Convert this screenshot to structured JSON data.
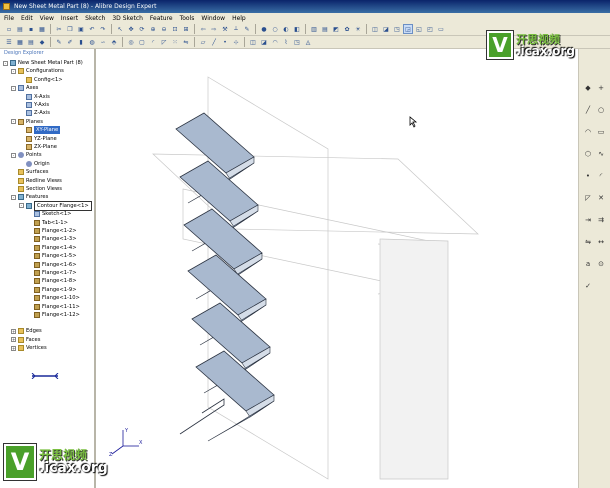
{
  "window": {
    "title": "New Sheet Metal Part (8) - Alibre Design Expert"
  },
  "menu": [
    "File",
    "Edit",
    "View",
    "Insert",
    "Sketch",
    "3D Sketch",
    "Feature",
    "Tools",
    "Window",
    "Help"
  ],
  "explorer": {
    "title": "Design Explorer",
    "items": [
      {
        "label": "New Sheet Metal Part (8)",
        "level": 0,
        "icon": "part-icon",
        "exp": "-"
      },
      {
        "label": "Configurations",
        "level": 1,
        "icon": "folder-icon",
        "exp": "-"
      },
      {
        "label": "Config<1>",
        "level": 2,
        "icon": "config-icon",
        "exp": ""
      },
      {
        "label": "Axes",
        "level": 1,
        "icon": "axes-icon",
        "exp": "-"
      },
      {
        "label": "X-Axis",
        "level": 2,
        "icon": "axis-icon",
        "exp": ""
      },
      {
        "label": "Y-Axis",
        "level": 2,
        "icon": "axis-icon",
        "exp": ""
      },
      {
        "label": "Z-Axis",
        "level": 2,
        "icon": "axis-icon",
        "exp": ""
      },
      {
        "label": "Planes",
        "level": 1,
        "icon": "planes-icon",
        "exp": "-"
      },
      {
        "label": "XY-Plane",
        "level": 2,
        "icon": "plane-icon",
        "exp": "",
        "selected": true
      },
      {
        "label": "YZ-Plane",
        "level": 2,
        "icon": "plane-icon",
        "exp": ""
      },
      {
        "label": "ZX-Plane",
        "level": 2,
        "icon": "plane-icon",
        "exp": ""
      },
      {
        "label": "Points",
        "level": 1,
        "icon": "points-icon",
        "exp": "-"
      },
      {
        "label": "Origin",
        "level": 2,
        "icon": "point-icon",
        "exp": ""
      },
      {
        "label": "Surfaces",
        "level": 1,
        "icon": "surfaces-icon",
        "exp": ""
      },
      {
        "label": "Redline Views",
        "level": 1,
        "icon": "redline-icon",
        "exp": ""
      },
      {
        "label": "Section Views",
        "level": 1,
        "icon": "section-icon",
        "exp": ""
      },
      {
        "label": "Features",
        "level": 1,
        "icon": "features-icon",
        "exp": "-"
      },
      {
        "label": "Contour Flange<1>",
        "level": 2,
        "icon": "contour-flange-icon",
        "exp": "-",
        "boxed": true
      },
      {
        "label": "Sketch<1>",
        "level": 3,
        "icon": "sketch-icon",
        "exp": ""
      },
      {
        "label": "Tab<1-1>",
        "level": 3,
        "icon": "tab-icon",
        "exp": ""
      },
      {
        "label": "Flange<1-2>",
        "level": 3,
        "icon": "flange-icon",
        "exp": ""
      },
      {
        "label": "Flange<1-3>",
        "level": 3,
        "icon": "flange-icon",
        "exp": ""
      },
      {
        "label": "Flange<1-4>",
        "level": 3,
        "icon": "flange-icon",
        "exp": ""
      },
      {
        "label": "Flange<1-5>",
        "level": 3,
        "icon": "flange-icon",
        "exp": ""
      },
      {
        "label": "Flange<1-6>",
        "level": 3,
        "icon": "flange-icon",
        "exp": ""
      },
      {
        "label": "Flange<1-7>",
        "level": 3,
        "icon": "flange-icon",
        "exp": ""
      },
      {
        "label": "Flange<1-8>",
        "level": 3,
        "icon": "flange-icon",
        "exp": ""
      },
      {
        "label": "Flange<1-9>",
        "level": 3,
        "icon": "flange-icon",
        "exp": ""
      },
      {
        "label": "Flange<1-10>",
        "level": 3,
        "icon": "flange-icon",
        "exp": ""
      },
      {
        "label": "Flange<1-11>",
        "level": 3,
        "icon": "flange-icon",
        "exp": ""
      },
      {
        "label": "Flange<1-12>",
        "level": 3,
        "icon": "flange-icon",
        "exp": ""
      },
      {
        "label": "Edges",
        "level": 1,
        "icon": "edges-icon",
        "exp": "+",
        "gap": true
      },
      {
        "label": "Faces",
        "level": 1,
        "icon": "faces-icon",
        "exp": "+"
      },
      {
        "label": "Vertices",
        "level": 1,
        "icon": "vertices-icon",
        "exp": "+"
      }
    ]
  },
  "watermark": {
    "letter": "V",
    "cn": "开思视频",
    "en": ".icax.org"
  },
  "axis_labels": {
    "x": "X",
    "y": "Y",
    "z": "Z"
  },
  "right_tools": [
    {
      "name": "paint-icon",
      "glyph": "◆"
    },
    {
      "name": "plus-icon",
      "glyph": "+"
    },
    {
      "name": "line-icon",
      "glyph": "╱"
    },
    {
      "name": "circle-icon",
      "glyph": "○"
    },
    {
      "name": "arc-icon",
      "glyph": "◠"
    },
    {
      "name": "rectangle-icon",
      "glyph": "▭"
    },
    {
      "name": "polygon-icon",
      "glyph": "⬡"
    },
    {
      "name": "spline-icon",
      "glyph": "∿"
    },
    {
      "name": "point-icon",
      "glyph": "•"
    },
    {
      "name": "fillet-icon",
      "glyph": "◜"
    },
    {
      "name": "chamfer-icon",
      "glyph": "◸"
    },
    {
      "name": "trim-icon",
      "glyph": "✕"
    },
    {
      "name": "extend-icon",
      "glyph": "⇥"
    },
    {
      "name": "offset-icon",
      "glyph": "⇉"
    },
    {
      "name": "mirror-icon",
      "glyph": "⇋"
    },
    {
      "name": "dimension-icon",
      "glyph": "↔"
    },
    {
      "name": "text-icon",
      "glyph": "a"
    },
    {
      "name": "constraint-icon",
      "glyph": "⊙"
    },
    {
      "name": "check-icon",
      "glyph": "✓"
    }
  ]
}
